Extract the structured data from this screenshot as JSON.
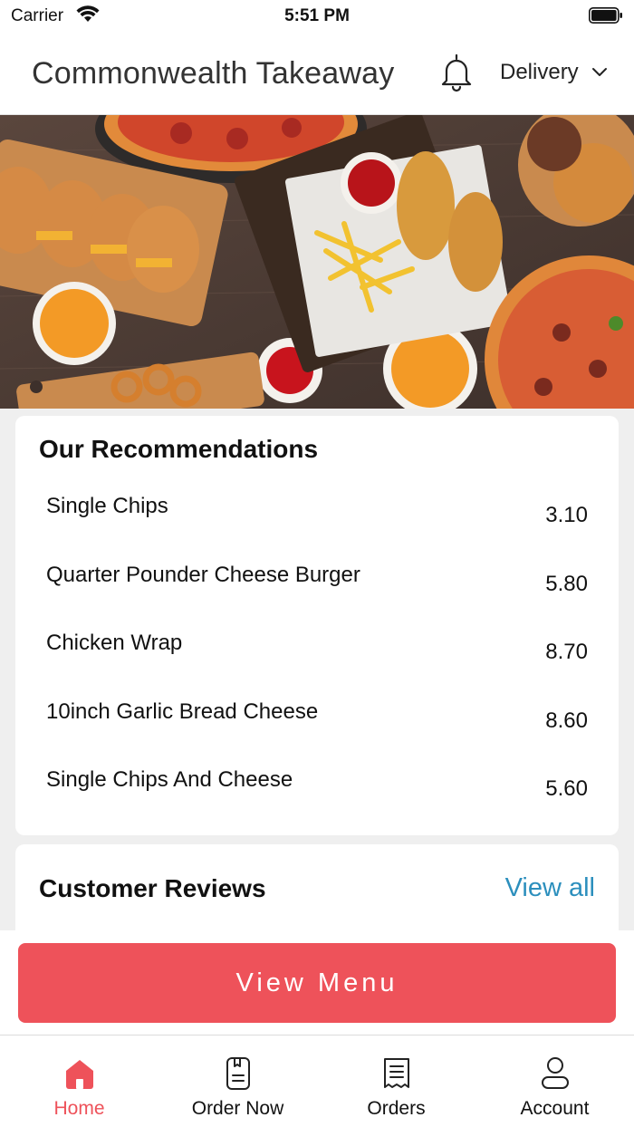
{
  "status_bar": {
    "carrier": "Carrier",
    "time": "5:51 PM"
  },
  "header": {
    "title": "Commonwealth Takeaway",
    "notification_icon": "bell-icon",
    "order_type": "Delivery"
  },
  "hero": {
    "image": "food spread photo"
  },
  "recommendations": {
    "title": "Our Recommendations",
    "items": [
      {
        "name": "Single Chips",
        "price": "3.10"
      },
      {
        "name": "Quarter Pounder Cheese Burger",
        "price": "5.80"
      },
      {
        "name": "Chicken Wrap",
        "price": "8.70"
      },
      {
        "name": "10inch Garlic Bread Cheese",
        "price": "8.60"
      },
      {
        "name": "Single Chips And Cheese",
        "price": "5.60"
      }
    ]
  },
  "reviews": {
    "title": "Customer Reviews",
    "view_all": "View all"
  },
  "view_menu_button": "View Menu",
  "tabs": [
    {
      "label": "Home",
      "icon": "home-icon",
      "active": true
    },
    {
      "label": "Order Now",
      "icon": "order-book-icon",
      "active": false
    },
    {
      "label": "Orders",
      "icon": "receipt-icon",
      "active": false
    },
    {
      "label": "Account",
      "icon": "user-icon",
      "active": false
    }
  ],
  "colors": {
    "accent": "#ee525a",
    "link": "#2c8fbd"
  }
}
